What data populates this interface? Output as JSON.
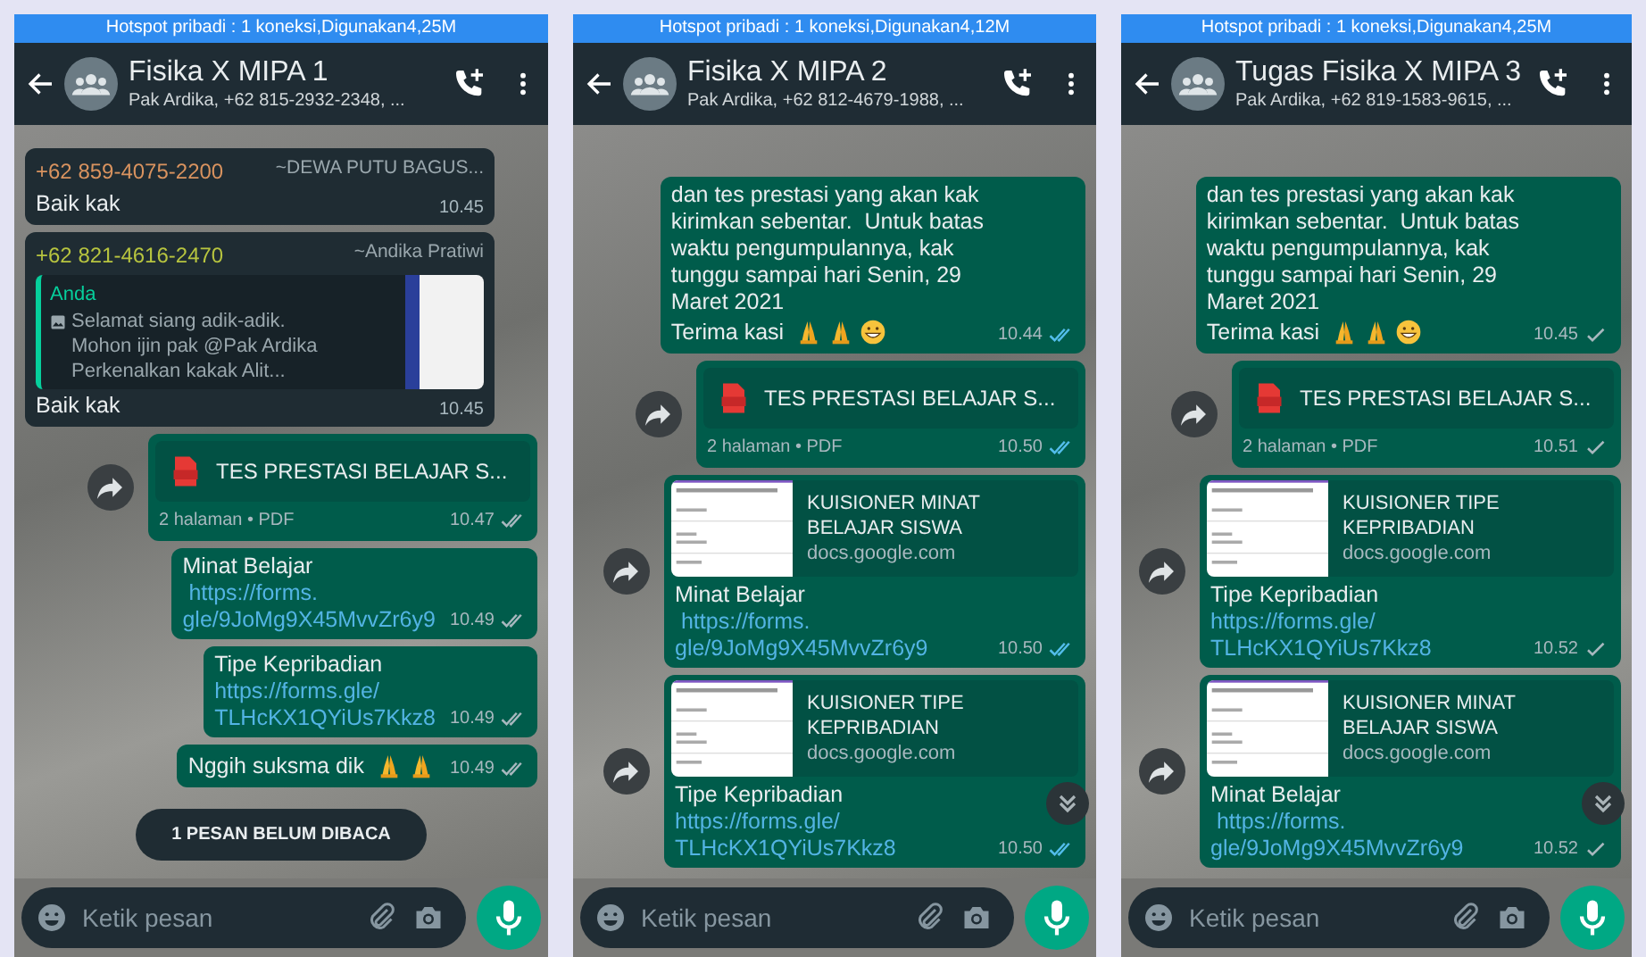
{
  "panels": [
    {
      "status_bar": "Hotspot pribadi : 1 koneksi,Digunakan4,25M",
      "title": "Fisika X MIPA 1",
      "subtitle": "Pak Ardika, +62 815-2932-2348, ...",
      "unread_banner": "1 PESAN BELUM DIBACA",
      "input": {
        "placeholder": "Ketik pesan"
      },
      "messages": [
        {
          "kind": "incoming",
          "sender": "+62 859-4075-2200",
          "color": "#d9935f",
          "sender_name": "~DEWA PUTU BAGUS...",
          "lines": [
            "Baik kak"
          ],
          "time": "10.45"
        },
        {
          "kind": "incoming",
          "sender": "+62 821-4616-2470",
          "color": "#b7c43f",
          "sender_name": "~Andika Pratiwi",
          "quote": {
            "author": "Anda",
            "lines": [
              "Selamat siang adik-adik.",
              "Mohon ijin pak @Pak Ardika",
              "Perkenalkan kakak Alit..."
            ]
          },
          "lines": [
            "Baik kak"
          ],
          "time": "10.45"
        },
        {
          "kind": "document",
          "forward": true,
          "title": "TES PRESTASI BELAJAR S...",
          "meta": "2 halaman • PDF",
          "time": "10.47",
          "delivered": true,
          "read": false
        },
        {
          "kind": "outgoing",
          "lines": [
            "Minat Belajar"
          ],
          "link_lines": [
            " https://forms.",
            "gle/9JoMg9X45MvvZr6y9"
          ],
          "time": "10.49",
          "delivered": true,
          "read": false
        },
        {
          "kind": "outgoing",
          "lines": [
            "Tipe Kepribadian"
          ],
          "link_lines": [
            "https://forms.gle/",
            "TLHcKX1QYiUs7Kkz8"
          ],
          "time": "10.49",
          "delivered": true,
          "read": false
        },
        {
          "kind": "outgoing",
          "emoji_line": {
            "text": "Nggih suksma dik",
            "emojis": [
              {
                "kind": "pray"
              },
              {
                "kind": "pray"
              }
            ]
          },
          "time": "10.49",
          "delivered": true,
          "read": false
        }
      ]
    },
    {
      "status_bar": "Hotspot pribadi : 1 koneksi,Digunakan4,12M",
      "title": "Fisika X MIPA 2",
      "subtitle": "Pak Ardika, +62 812-4679-1988, ...",
      "scroll_button": true,
      "input": {
        "placeholder": "Ketik pesan"
      },
      "messages": [
        {
          "kind": "outgoing",
          "lines": [
            "dan tes prestasi yang akan kak",
            "kirimkan sebentar.  Untuk batas",
            "waktu pengumpulannya, kak",
            "tunggu sampai hari Senin, 29",
            "Maret 2021"
          ],
          "emoji_line": {
            "text": "Terima kasi",
            "emojis": [
              {
                "kind": "pray"
              },
              {
                "kind": "pray"
              },
              {
                "kind": "grin"
              }
            ]
          },
          "time": "10.44",
          "delivered": true,
          "read": true
        },
        {
          "kind": "document",
          "forward": true,
          "title": "TES PRESTASI BELAJAR S...",
          "meta": "2 halaman • PDF",
          "time": "10.50",
          "delivered": true,
          "read": true
        },
        {
          "kind": "outgoing",
          "forward": true,
          "preview": {
            "title": "KUISIONER MINAT BELAJAR SISWA",
            "domain": "docs.google.com"
          },
          "lines": [
            "Minat Belajar"
          ],
          "link_lines": [
            " https://forms.",
            "gle/9JoMg9X45MvvZr6y9"
          ],
          "time": "10.50",
          "delivered": true,
          "read": true
        },
        {
          "kind": "outgoing",
          "forward": true,
          "preview": {
            "title": "KUISIONER TIPE KEPRIBADIAN",
            "domain": "docs.google.com"
          },
          "lines": [
            "Tipe Kepribadian"
          ],
          "link_lines": [
            "https://forms.gle/",
            "TLHcKX1QYiUs7Kkz8"
          ],
          "time": "10.50",
          "delivered": true,
          "read": true
        }
      ]
    },
    {
      "status_bar": "Hotspot pribadi : 1 koneksi,Digunakan4,25M",
      "title": "Tugas Fisika X MIPA 3",
      "subtitle": "Pak Ardika, +62 819-1583-9615, ...",
      "scroll_button": true,
      "input": {
        "placeholder": "Ketik pesan"
      },
      "messages": [
        {
          "kind": "outgoing",
          "lines": [
            "dan tes prestasi yang akan kak",
            "kirimkan sebentar.  Untuk batas",
            "waktu pengumpulannya, kak",
            "tunggu sampai hari Senin, 29",
            "Maret 2021"
          ],
          "emoji_line": {
            "text": "Terima kasi",
            "emojis": [
              {
                "kind": "pray"
              },
              {
                "kind": "pray"
              },
              {
                "kind": "grin"
              }
            ]
          },
          "time": "10.45",
          "delivered": false,
          "read": false
        },
        {
          "kind": "document",
          "forward": true,
          "title": "TES PRESTASI BELAJAR S...",
          "meta": "2 halaman • PDF",
          "time": "10.51",
          "delivered": false,
          "read": false
        },
        {
          "kind": "outgoing",
          "forward": true,
          "preview": {
            "title": "KUISIONER TIPE KEPRIBADIAN",
            "domain": "docs.google.com"
          },
          "lines": [
            "Tipe Kepribadian"
          ],
          "link_lines": [
            "https://forms.gle/",
            "TLHcKX1QYiUs7Kkz8"
          ],
          "time": "10.52",
          "delivered": false,
          "read": false
        },
        {
          "kind": "outgoing",
          "forward": true,
          "preview": {
            "title": "KUISIONER MINAT BELAJAR SISWA",
            "domain": "docs.google.com"
          },
          "lines": [
            "Minat Belajar"
          ],
          "link_lines": [
            " https://forms.",
            "gle/9JoMg9X45MvvZr6y9"
          ],
          "time": "10.52",
          "delivered": false,
          "read": false
        }
      ]
    }
  ]
}
